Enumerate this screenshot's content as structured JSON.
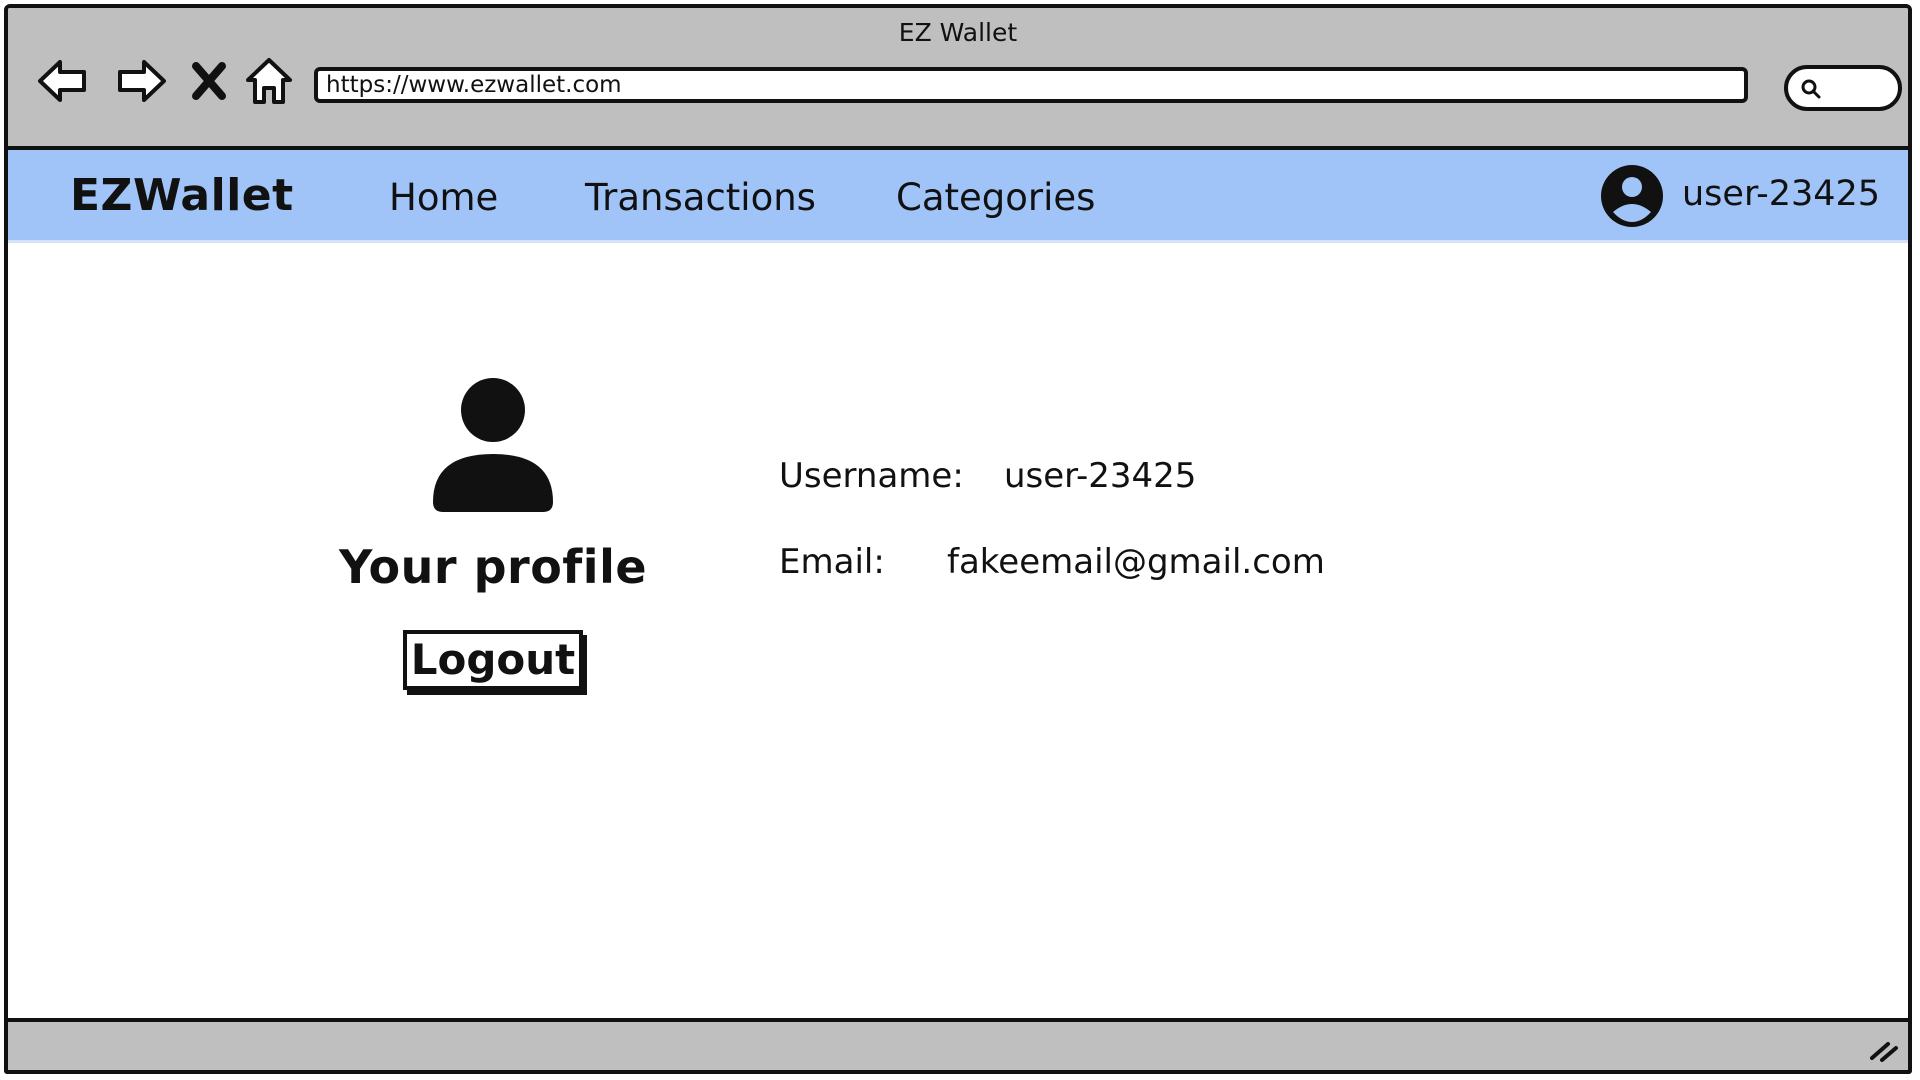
{
  "window": {
    "title": "EZ Wallet"
  },
  "browser": {
    "url": "https://www.ezwallet.com",
    "buttons": {
      "back": "back-arrow-icon",
      "forward": "forward-arrow-icon",
      "stop": "close-icon",
      "home": "home-icon",
      "search": "search-icon"
    }
  },
  "nav": {
    "brand": "EZWallet",
    "links": [
      "Home",
      "Transactions",
      "Categories"
    ],
    "user": {
      "name": "user-23425",
      "icon": "account-circle-icon"
    }
  },
  "profile": {
    "icon": "person-icon",
    "title": "Your profile",
    "logout_label": "Logout",
    "fields": [
      {
        "label": "Username:",
        "value": "user-23425"
      },
      {
        "label": "Email:",
        "value": "fakeemail@gmail.com"
      }
    ]
  },
  "colors": {
    "chrome": "#bfbfbf",
    "nav_bg": "#a0c4f7",
    "ink": "#111111"
  }
}
